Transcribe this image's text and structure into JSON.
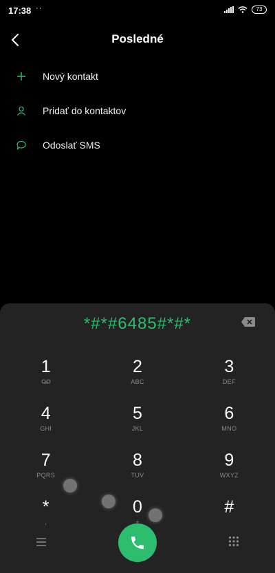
{
  "status_bar": {
    "time": "17:38",
    "dots": "··",
    "battery": "73"
  },
  "header": {
    "title": "Posledné"
  },
  "menu": {
    "items": [
      {
        "label": "Nový kontakt",
        "icon": "plus-icon"
      },
      {
        "label": "Pridať do kontaktov",
        "icon": "person-icon"
      },
      {
        "label": "Odoslať SMS",
        "icon": "message-icon"
      }
    ]
  },
  "dialer": {
    "number": "*#*#6485#*#*",
    "keys": [
      {
        "digit": "1",
        "letters": ""
      },
      {
        "digit": "2",
        "letters": "ABC"
      },
      {
        "digit": "3",
        "letters": "DEF"
      },
      {
        "digit": "4",
        "letters": "GHI"
      },
      {
        "digit": "5",
        "letters": "JKL"
      },
      {
        "digit": "6",
        "letters": "MNO"
      },
      {
        "digit": "7",
        "letters": "PQRS"
      },
      {
        "digit": "8",
        "letters": "TUV"
      },
      {
        "digit": "9",
        "letters": "WXYZ"
      },
      {
        "digit": "*",
        "letters": ","
      },
      {
        "digit": "0",
        "letters": "+"
      },
      {
        "digit": "#",
        "letters": ""
      }
    ]
  },
  "colors": {
    "accent": "#2dbd6f",
    "panel": "#232323",
    "background": "#000000"
  }
}
